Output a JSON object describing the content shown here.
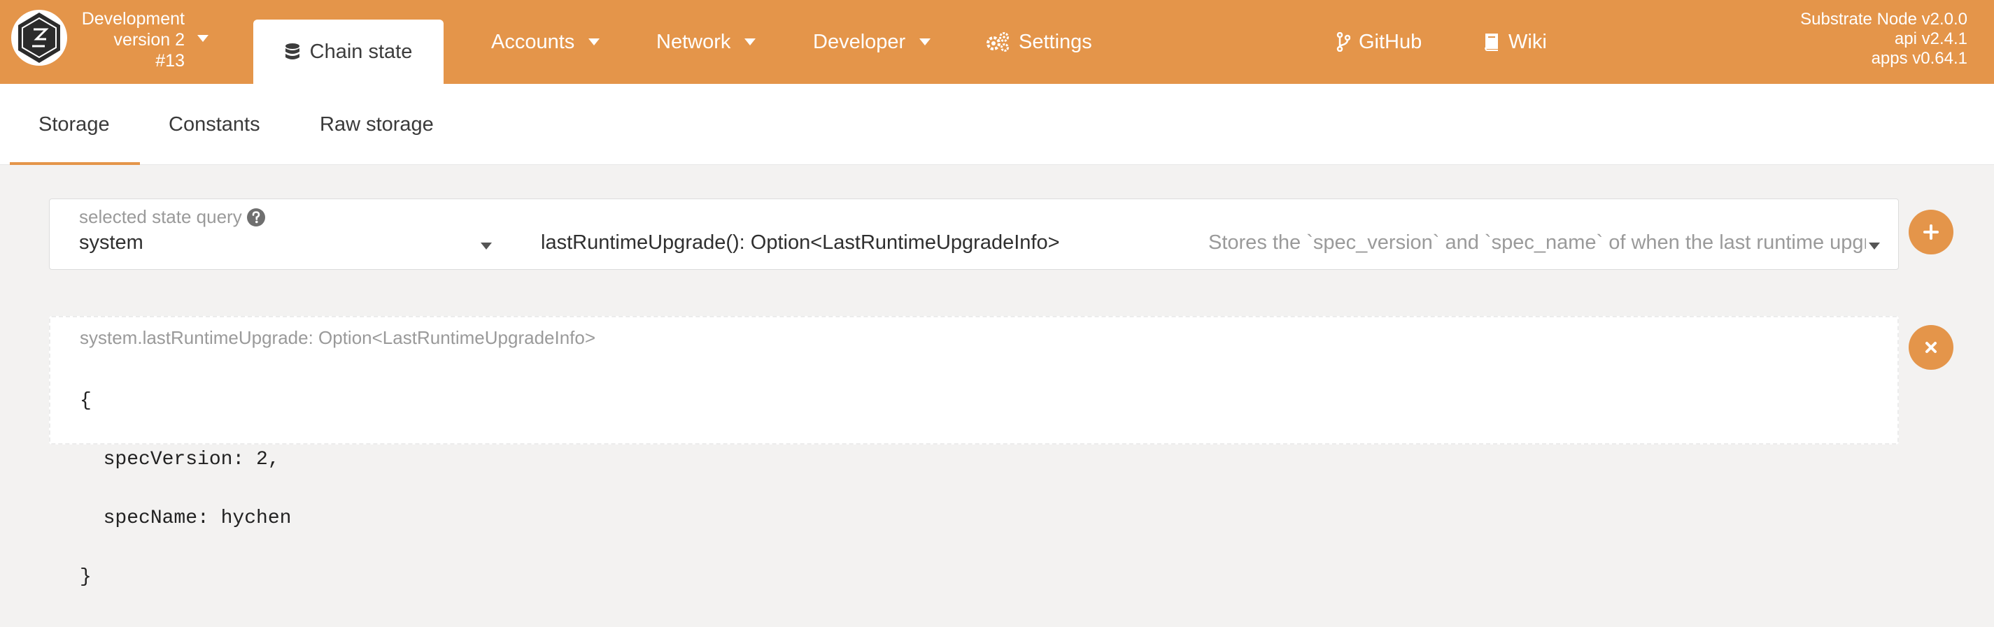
{
  "header": {
    "chain": {
      "name": "Development",
      "version": "version 2",
      "block": "#13"
    },
    "nav": {
      "active": {
        "label": "Chain state",
        "icon": "database-icon"
      },
      "accounts": "Accounts",
      "network": "Network",
      "developer": "Developer",
      "settings": "Settings",
      "github": "GitHub",
      "wiki": "Wiki"
    },
    "versions": {
      "node": "Substrate Node v2.0.0",
      "api": "api v2.4.1",
      "apps": "apps v0.64.1"
    },
    "accent_color": "#e4954a"
  },
  "tabs": {
    "storage": "Storage",
    "constants": "Constants",
    "raw_storage": "Raw storage",
    "active": "Storage"
  },
  "query": {
    "label": "selected state query",
    "section": "system",
    "method": "lastRuntimeUpgrade(): Option<LastRuntimeUpgradeInfo>",
    "description": "Stores the `spec_version` and `spec_name` of when the last runtime upgrade happened."
  },
  "result": {
    "label": "system.lastRuntimeUpgrade: Option<LastRuntimeUpgradeInfo>",
    "lines": [
      "{",
      "  specVersion: 2,",
      "  specName: hychen",
      "}"
    ]
  }
}
